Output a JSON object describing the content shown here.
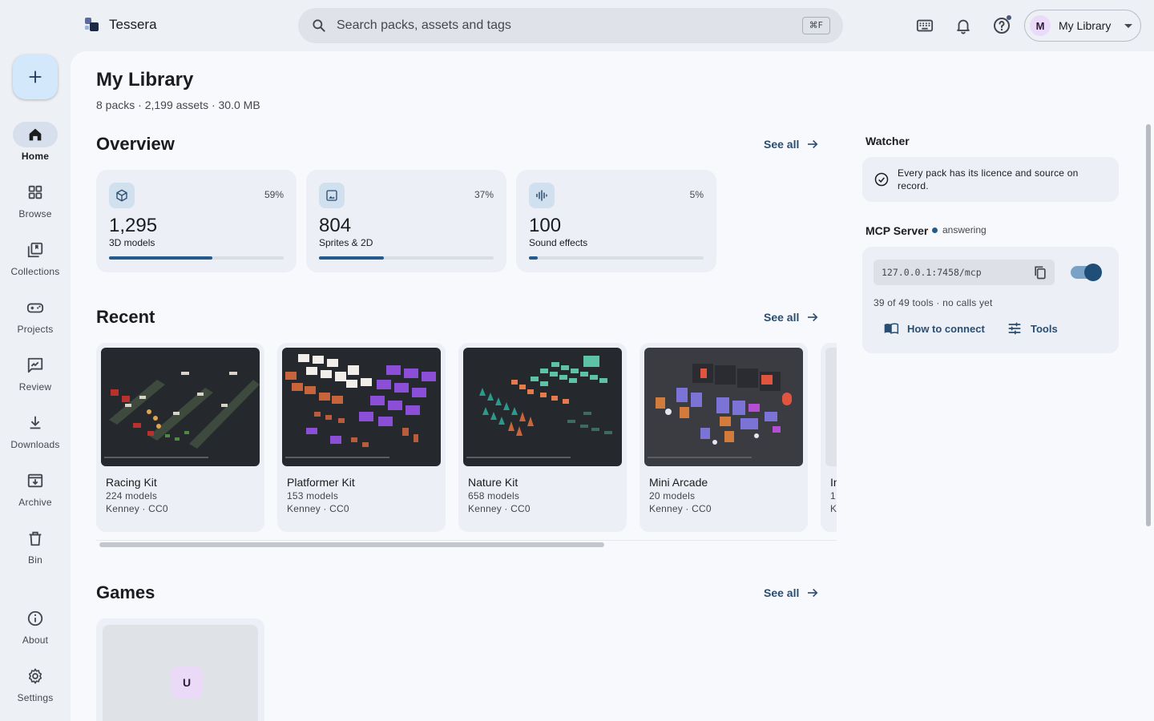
{
  "app": {
    "name": "Tessera"
  },
  "search": {
    "placeholder": "Search packs, assets and tags",
    "shortcut": "⌘F"
  },
  "profile": {
    "initial": "M",
    "label": "My Library"
  },
  "nav": {
    "items": [
      {
        "label": "Home",
        "icon": "home-icon",
        "active": true
      },
      {
        "label": "Browse",
        "icon": "grid-icon"
      },
      {
        "label": "Collections",
        "icon": "collections-icon"
      },
      {
        "label": "Projects",
        "icon": "gamepad-icon"
      },
      {
        "label": "Review",
        "icon": "review-icon"
      },
      {
        "label": "Downloads",
        "icon": "download-icon"
      },
      {
        "label": "Archive",
        "icon": "archive-icon"
      },
      {
        "label": "Bin",
        "icon": "trash-icon"
      },
      {
        "label": "About",
        "icon": "info-icon"
      },
      {
        "label": "Settings",
        "icon": "gear-icon"
      }
    ]
  },
  "page": {
    "title": "My Library",
    "subtitle": "8 packs · 2,199 assets · 30.0 MB"
  },
  "overview": {
    "title": "Overview",
    "see_all": "See all",
    "stats": [
      {
        "value": "1,295",
        "label": "3D models",
        "percent": "59%",
        "fraction": 0.59,
        "icon": "cube-icon"
      },
      {
        "value": "804",
        "label": "Sprites & 2D",
        "percent": "37%",
        "fraction": 0.37,
        "icon": "image-icon"
      },
      {
        "value": "100",
        "label": "Sound effects",
        "percent": "5%",
        "fraction": 0.05,
        "icon": "waveform-icon"
      }
    ]
  },
  "recent": {
    "title": "Recent",
    "see_all": "See all",
    "packs": [
      {
        "name": "Racing Kit",
        "count": "224 models",
        "license": "Kenney · CC0"
      },
      {
        "name": "Platformer Kit",
        "count": "153 models",
        "license": "Kenney · CC0"
      },
      {
        "name": "Nature Kit",
        "count": "658 models",
        "license": "Kenney · CC0"
      },
      {
        "name": "Mini Arcade",
        "count": "20 models",
        "license": "Kenney · CC0"
      },
      {
        "name": "In",
        "count": "1",
        "license": "K"
      }
    ]
  },
  "games": {
    "title": "Games",
    "see_all": "See all",
    "card_initial": "U"
  },
  "watcher": {
    "title": "Watcher",
    "message": "Every pack has its licence and source on record."
  },
  "mcp": {
    "title": "MCP Server",
    "status": "answering",
    "address": "127.0.0.1:7458/mcp",
    "enabled": true,
    "meta": "39 of 49 tools · no calls yet",
    "connect_label": "How to connect",
    "tools_label": "Tools"
  },
  "colors": {
    "accent": "#245a8c",
    "link": "#2b4d70",
    "surface": "#f8f9fc",
    "background": "#edf0f5"
  }
}
